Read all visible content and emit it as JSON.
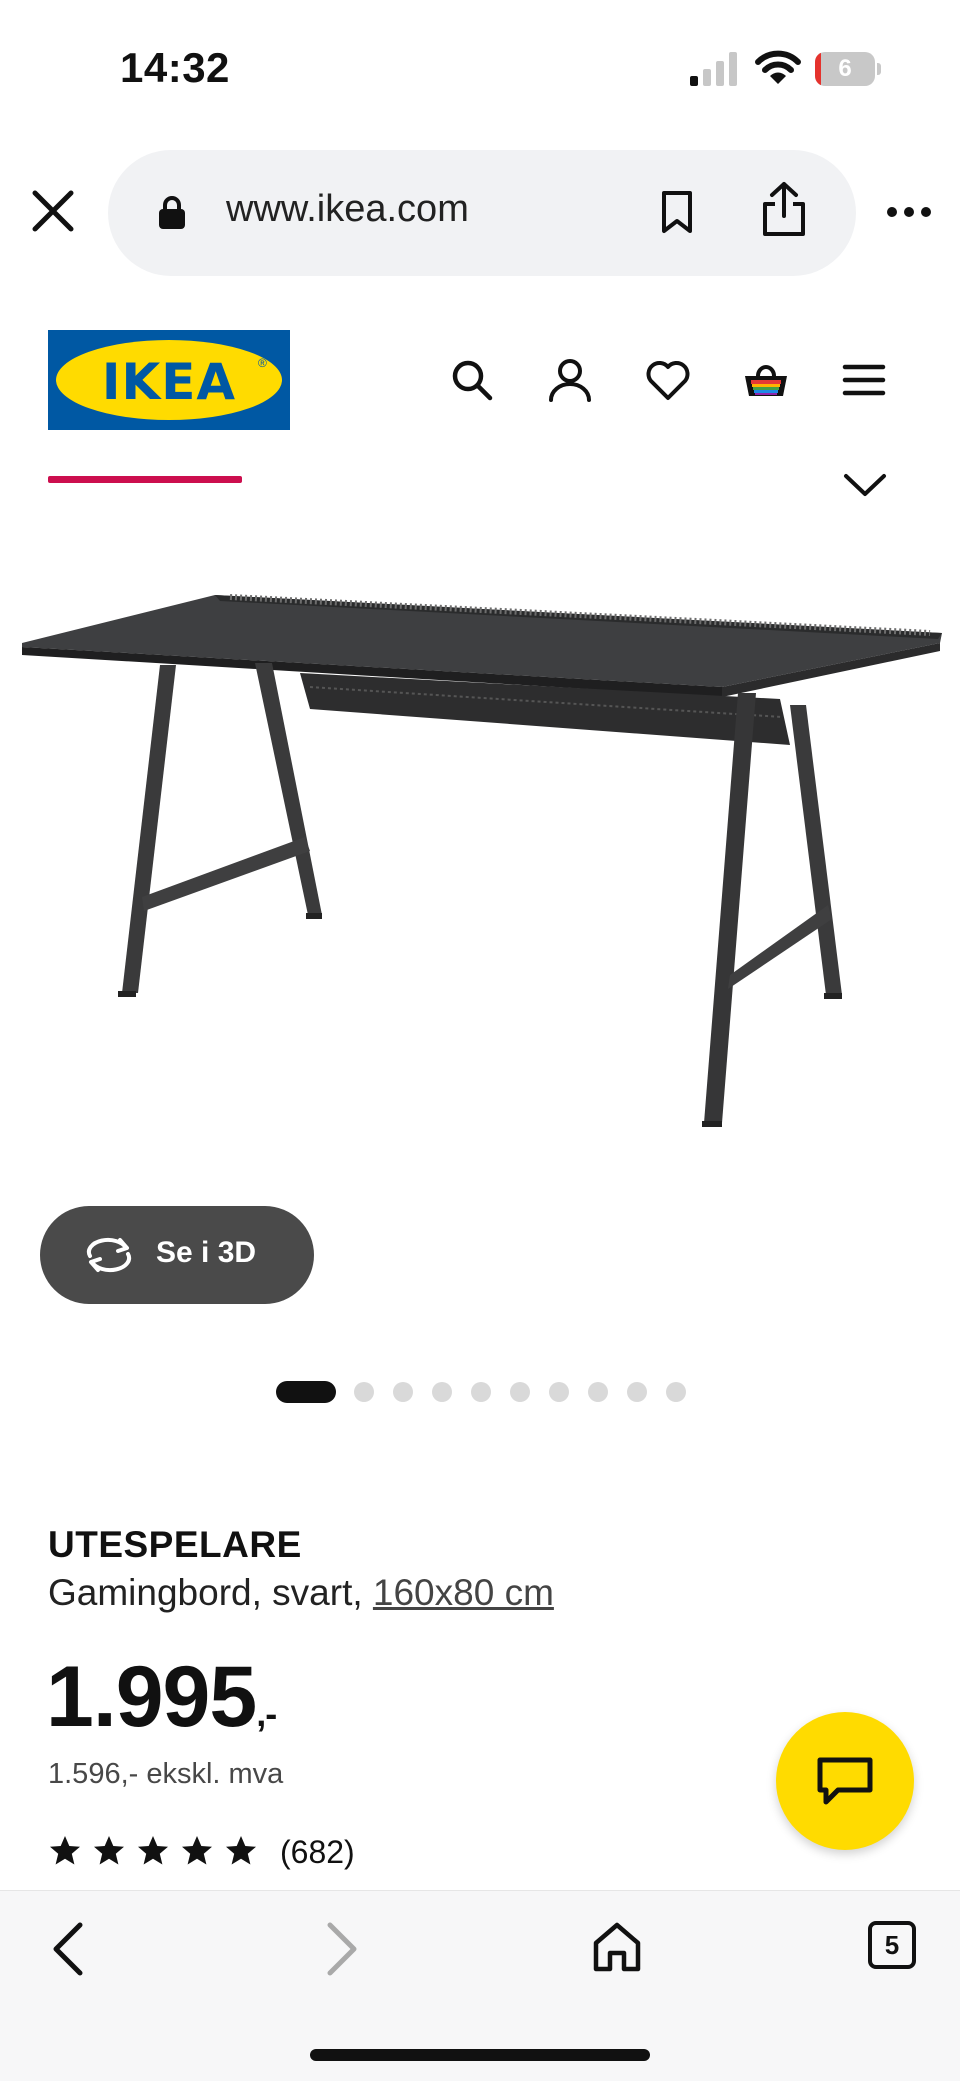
{
  "status_bar": {
    "time": "14:32",
    "battery_level": "6",
    "battery_fraction": 0.1
  },
  "browser": {
    "url": "www.ikea.com",
    "tab_count": "5"
  },
  "site": {
    "logo_text": "IKEA",
    "brand_colors": {
      "blue": "#0058a3",
      "yellow": "#ffdb00",
      "accent": "#cc0e4e"
    },
    "header_icons": [
      "search-icon",
      "account-icon",
      "heart-icon",
      "basket-icon",
      "menu-icon"
    ]
  },
  "product": {
    "view_3d_label": "Se i 3D",
    "image_count": 10,
    "active_image_index": 0,
    "name": "UTESPELARE",
    "description": "Gamingbord, svart, ",
    "size_link": "160x80 cm",
    "price_main": "1.995",
    "price_suffix": ",-",
    "price_ex_vat": "1.596,- ekskl. mva",
    "rating": 5,
    "rating_count": "(682)"
  }
}
